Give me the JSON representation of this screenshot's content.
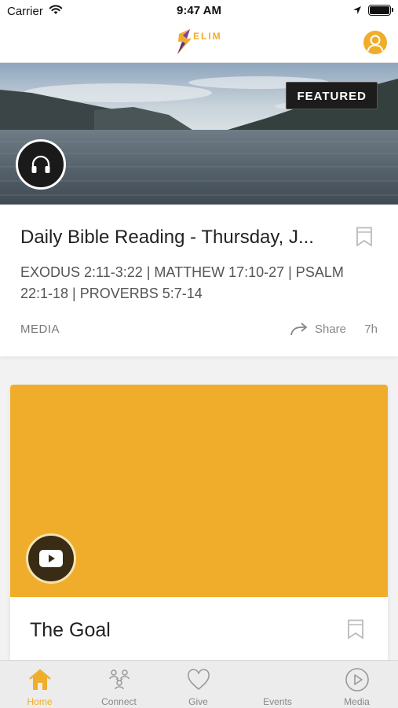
{
  "status_bar": {
    "carrier": "Carrier",
    "time": "9:47 AM"
  },
  "header": {
    "logo_text": "ELIM",
    "logo_icon": "elim-logo-icon",
    "profile_icon": "person-icon"
  },
  "feed": [
    {
      "badge": "FEATURED",
      "media_icon": "headphones-icon",
      "title": "Daily Bible Reading - Thursday, J...",
      "subtitle": "EXODUS 2:11-3:22 | MATTHEW 17:10-27 | PSALM 22:1-18 | PROVERBS 5:7-14",
      "category": "MEDIA",
      "share_label": "Share",
      "age": "7h"
    },
    {
      "media_icon": "play-video-icon",
      "title": "The Goal"
    }
  ],
  "tabs": [
    {
      "label": "Home",
      "icon": "home-icon",
      "active": true
    },
    {
      "label": "Connect",
      "icon": "people-icon",
      "active": false
    },
    {
      "label": "Give",
      "icon": "heart-icon",
      "active": false
    },
    {
      "label": "Events",
      "icon": "calendar-icon",
      "active": false
    },
    {
      "label": "Media",
      "icon": "play-circle-icon",
      "active": false
    }
  ],
  "colors": {
    "accent": "#f0ad2b",
    "dark": "#1a1a1a",
    "muted": "#888888"
  }
}
